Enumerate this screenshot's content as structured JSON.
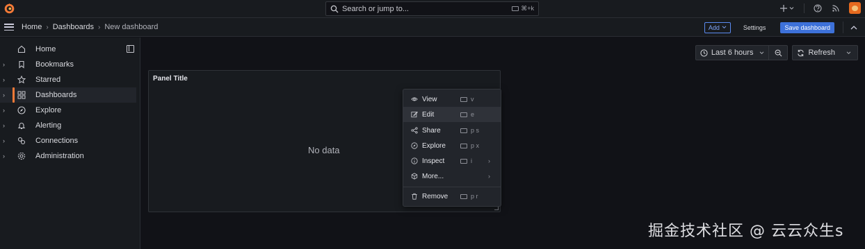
{
  "topbar": {
    "search_placeholder": "Search or jump to...",
    "search_shortcut": "⌘+k",
    "icons": [
      "grafana-logo",
      "search-icon",
      "plus-icon",
      "help-icon",
      "news-icon",
      "user-avatar"
    ]
  },
  "breadcrumb": {
    "items": [
      "Home",
      "Dashboards",
      "New dashboard"
    ]
  },
  "toolbar": {
    "add_label": "Add",
    "settings_label": "Settings",
    "save_label": "Save dashboard"
  },
  "sidebar": {
    "items": [
      {
        "label": "Home",
        "icon": "home-icon",
        "expandable": false,
        "active": false
      },
      {
        "label": "Bookmarks",
        "icon": "bookmark-icon",
        "expandable": true,
        "active": false
      },
      {
        "label": "Starred",
        "icon": "star-icon",
        "expandable": true,
        "active": false
      },
      {
        "label": "Dashboards",
        "icon": "apps-icon",
        "expandable": true,
        "active": true
      },
      {
        "label": "Explore",
        "icon": "compass-icon",
        "expandable": true,
        "active": false
      },
      {
        "label": "Alerting",
        "icon": "bell-icon",
        "expandable": true,
        "active": false
      },
      {
        "label": "Connections",
        "icon": "link-icon",
        "expandable": true,
        "active": false
      },
      {
        "label": "Administration",
        "icon": "cog-icon",
        "expandable": true,
        "active": false
      }
    ]
  },
  "controls": {
    "time_range": "Last 6 hours",
    "refresh_label": "Refresh"
  },
  "panel": {
    "title": "Panel Title",
    "empty_text": "No data"
  },
  "menu": {
    "items": [
      {
        "label": "View",
        "shortcut": "v",
        "icon": "eye-icon",
        "submenu": false
      },
      {
        "label": "Edit",
        "shortcut": "e",
        "icon": "edit-icon",
        "submenu": false,
        "highlighted": true
      },
      {
        "label": "Share",
        "shortcut": "p s",
        "icon": "share-icon",
        "submenu": false
      },
      {
        "label": "Explore",
        "shortcut": "p x",
        "icon": "compass-icon",
        "submenu": false
      },
      {
        "label": "Inspect",
        "shortcut": "i",
        "icon": "info-icon",
        "submenu": true
      },
      {
        "label": "More...",
        "shortcut": "",
        "icon": "cube-icon",
        "submenu": true
      },
      {
        "label": "Remove",
        "shortcut": "p r",
        "icon": "trash-icon",
        "submenu": false
      }
    ]
  },
  "watermark": "掘金技术社区 @ 云云众生s",
  "colors": {
    "accent": "#3d71d9",
    "active_bar": "#f47a37",
    "background": "#111217",
    "surface": "#181b1f"
  }
}
